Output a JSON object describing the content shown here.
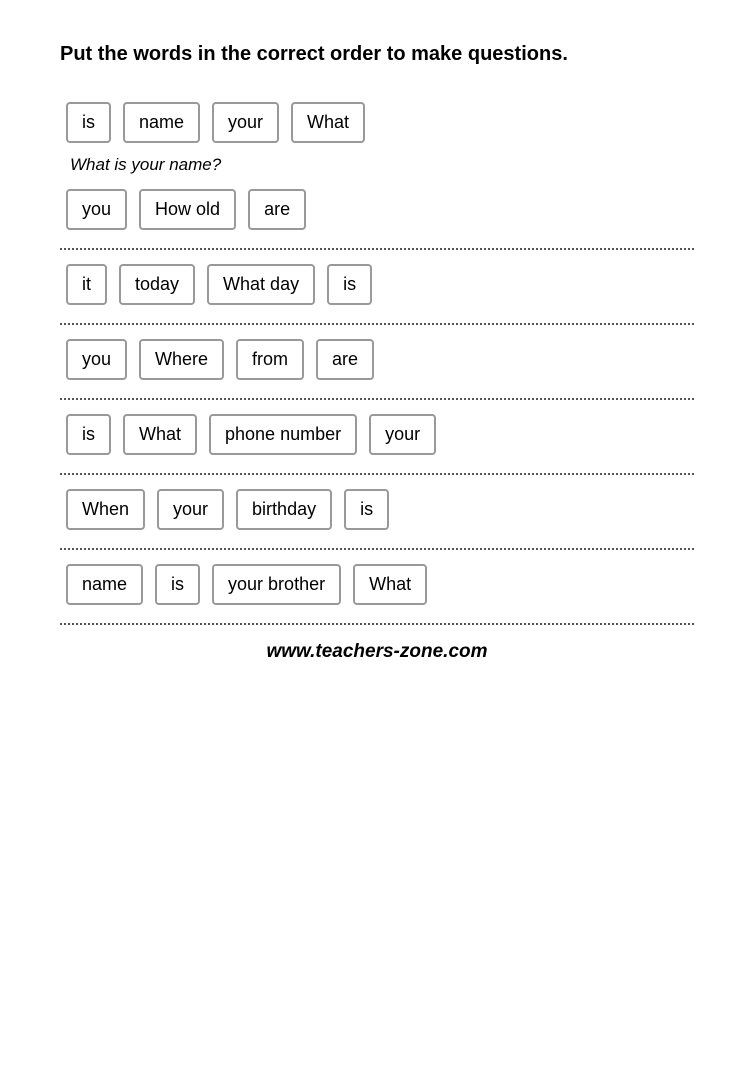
{
  "title": "Put the words in the correct order to make questions.",
  "rows": [
    {
      "id": "row1",
      "words": [
        "is",
        "name",
        "your",
        "What"
      ],
      "answer": "What is your name?"
    },
    {
      "id": "row2",
      "words": [
        "you",
        "How old",
        "are"
      ],
      "answer": null
    },
    {
      "id": "row3",
      "words": [
        "it",
        "today",
        "What day",
        "is"
      ],
      "answer": null
    },
    {
      "id": "row4",
      "words": [
        "you",
        "Where",
        "from",
        "are"
      ],
      "answer": null
    },
    {
      "id": "row5",
      "words": [
        "is",
        "What",
        "phone number",
        "your"
      ],
      "answer": null
    },
    {
      "id": "row6",
      "words": [
        "When",
        "your",
        "birthday",
        "is"
      ],
      "answer": null
    },
    {
      "id": "row7",
      "words": [
        "name",
        "is",
        "your brother",
        "What"
      ],
      "answer": null
    }
  ],
  "footer": "www.teachers-zone.com"
}
